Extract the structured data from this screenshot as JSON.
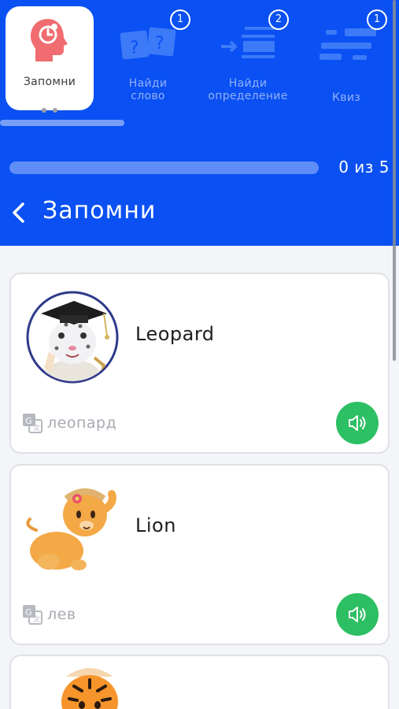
{
  "modes": {
    "tabs": [
      {
        "label": "Запомни",
        "active": true,
        "icon": "brain-head-icon"
      },
      {
        "label": "Найди\nслово",
        "badge": "1",
        "icon": "question-cards-icon"
      },
      {
        "label": "Найди\nопределение",
        "badge": "2",
        "icon": "arrow-to-lines-icon"
      },
      {
        "label": "Квиз",
        "badge": "1",
        "icon": "quiz-lines-icon"
      }
    ]
  },
  "progress": {
    "text": "0 из 5",
    "fraction": 0.0
  },
  "header": {
    "title": "Запомни"
  },
  "cards": [
    {
      "word": "Leopard",
      "translation": "леопард",
      "image": "leopard-mascot"
    },
    {
      "word": "Lion",
      "translation": "лев",
      "image": "lion-cub"
    },
    {
      "word": "",
      "translation": "",
      "image": "tiger-cub"
    }
  ],
  "colors": {
    "header_bg": "#0a50f2",
    "sound_button": "#2dbf63",
    "brain_icon": "#f06c70"
  }
}
